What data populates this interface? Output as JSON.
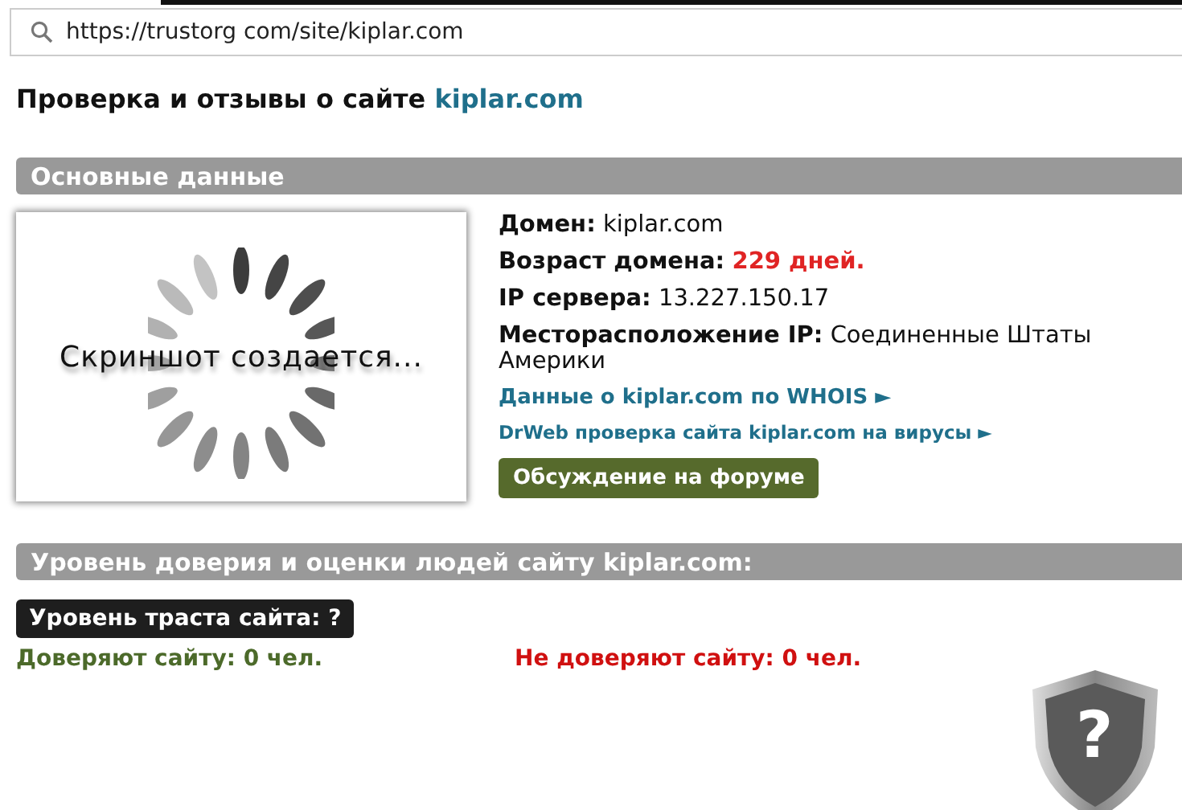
{
  "address_bar": {
    "url": "https://trustorg com/site/kiplar.com"
  },
  "heading": {
    "text": "Проверка и отзывы о сайте ",
    "site": "kiplar.com"
  },
  "main_section": {
    "title": "Основные данные",
    "screenshot": {
      "caption": "Скриншот создается..."
    },
    "facts": [
      {
        "label": "Домен:",
        "value": "kiplar.com"
      },
      {
        "label": "Возраст домена:",
        "value": "229 дней.",
        "color": "#e02424"
      },
      {
        "label": "IP сервера:",
        "value": "13.227.150.17"
      },
      {
        "label": "Месторасположение IP:",
        "value": "Соединенные Штаты Америки"
      }
    ],
    "links": [
      {
        "text": "Данные о kiplar.com по WHOIS ►",
        "kind": "large"
      },
      {
        "text": "DrWeb проверка сайта kiplar.com на вирусы ►",
        "kind": "small"
      }
    ],
    "forum_button": "Обсуждение на форуме"
  },
  "trust_section": {
    "title": "Уровень доверия и оценки людей сайту kiplar.com:",
    "trust_level": "Уровень траста сайта: ?",
    "trusting": "Доверяют сайту: 0 чел.",
    "distrusting": "Не доверяют сайту: 0 чел.",
    "shield_mark": "?"
  }
}
